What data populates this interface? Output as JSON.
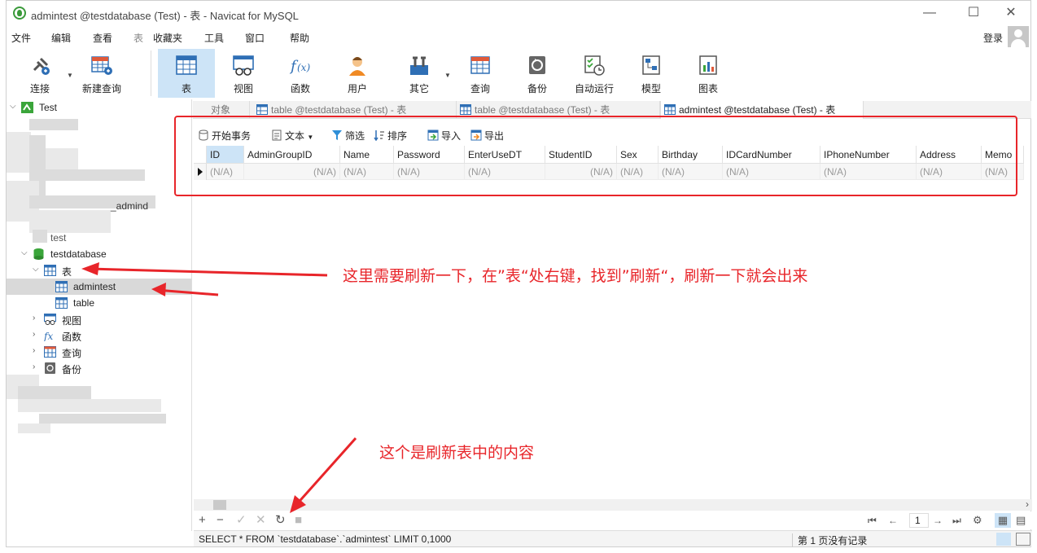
{
  "window": {
    "title": "admintest @testdatabase (Test) - 表 - Navicat for MySQL",
    "minimize": "—",
    "maximize": "☐",
    "close": "✕"
  },
  "menu": [
    "文件",
    "编辑",
    "查看",
    "表",
    "收藏夹",
    "工具",
    "窗口",
    "帮助"
  ],
  "login": "登录",
  "toolbar": [
    {
      "label": "连接",
      "icon": "plug-icon"
    },
    {
      "label": "新建查询",
      "icon": "new-query-icon"
    },
    {
      "label": "表",
      "icon": "table-icon",
      "active": true
    },
    {
      "label": "视图",
      "icon": "view-icon"
    },
    {
      "label": "函数",
      "icon": "function-icon"
    },
    {
      "label": "用户",
      "icon": "user-icon"
    },
    {
      "label": "其它",
      "icon": "tools-icon"
    },
    {
      "label": "查询",
      "icon": "query-icon"
    },
    {
      "label": "备份",
      "icon": "backup-icon"
    },
    {
      "label": "自动运行",
      "icon": "schedule-icon"
    },
    {
      "label": "模型",
      "icon": "model-icon"
    },
    {
      "label": "图表",
      "icon": "chart-icon"
    }
  ],
  "sidebar": {
    "connection": "Test",
    "partial_text_1": "_admind",
    "partial_text_2": "test",
    "database": "testdatabase",
    "tables_group": "表",
    "tables": [
      "admintest",
      "table"
    ],
    "groups": [
      "视图",
      "函数",
      "查询",
      "备份"
    ]
  },
  "tabs": [
    "对象",
    "table @testdatabase (Test) - 表",
    "table @testdatabase (Test) - 表",
    "admintest @testdatabase (Test) - 表"
  ],
  "subtoolbar": {
    "begin_transaction": "开始事务",
    "text": "文本",
    "filter": "筛选",
    "sort": "排序",
    "import": "导入",
    "export": "导出"
  },
  "grid": {
    "columns": [
      "ID",
      "AdminGroupID",
      "Name",
      "Password",
      "EnterUseDT",
      "StudentID",
      "Sex",
      "Birthday",
      "IDCardNumber",
      "IPhoneNumber",
      "Address",
      "Memo"
    ],
    "row": [
      "(N/A)",
      "(N/A)",
      "(N/A)",
      "(N/A)",
      "(N/A)",
      "(N/A)",
      "(N/A)",
      "(N/A)",
      "(N/A)",
      "(N/A)",
      "(N/A)",
      "(N/A)"
    ]
  },
  "annotations": {
    "note_refresh_tree": "这里需要刷新一下，在”表“处右键，找到”刷新“，刷新一下就会出来",
    "note_refresh_table": "这个是刷新表中的内容"
  },
  "pagination": {
    "page": "1"
  },
  "status": {
    "sql": "SELECT * FROM `testdatabase`.`admintest` LIMIT 0,1000",
    "record": "第 1 页没有记录"
  },
  "colors": {
    "accent": "#cde4f7",
    "annotation": "#e8252a",
    "db_green": "#3aa53a",
    "table_blue": "#2f6fb5"
  }
}
